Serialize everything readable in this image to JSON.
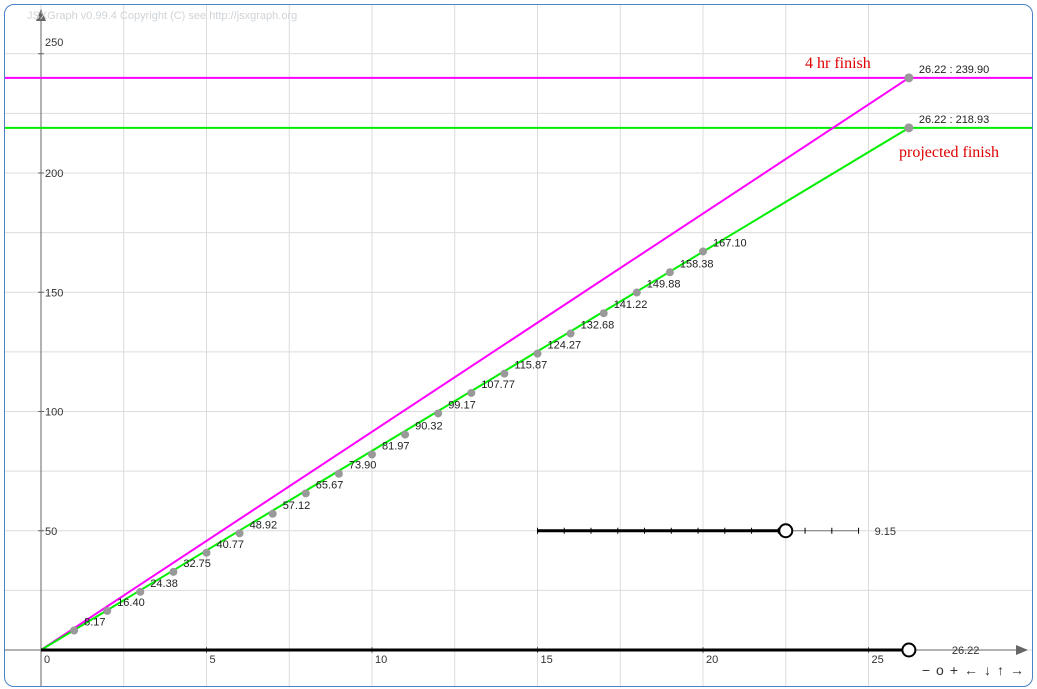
{
  "board": {
    "copyright": "JSXGraph v0.99.4 Copyright (C) see http://jsxgraph.org",
    "nav": [
      {
        "name": "zoom-out-button",
        "label": "−"
      },
      {
        "name": "zoom-reset-button",
        "label": "o"
      },
      {
        "name": "zoom-in-button",
        "label": "+"
      },
      {
        "name": "pan-left-button",
        "label": "←"
      },
      {
        "name": "pan-down-button",
        "label": "↓"
      },
      {
        "name": "pan-up-button",
        "label": "↑"
      },
      {
        "name": "pan-right-button",
        "label": "→"
      }
    ]
  },
  "colors": {
    "grid": "#dcdcdc",
    "axis": "#666666",
    "target_line": "#ff00ff",
    "projected_line": "#00ee00",
    "point": "#999999",
    "annotation": "#dd0000",
    "slider": "#000000"
  },
  "chart_data": {
    "type": "line",
    "xlim": [
      0,
      26.9
    ],
    "ylim": [
      -15,
      270
    ],
    "x_ticks": [
      0,
      5,
      10,
      15,
      20,
      25
    ],
    "x_tick_labels": [
      "0",
      "5",
      "10",
      "15",
      "20",
      "25"
    ],
    "y_ticks": [
      50,
      100,
      150,
      200,
      250
    ],
    "y_tick_labels": [
      "50",
      "100",
      "150",
      "200",
      "250"
    ],
    "grid": true,
    "series": [
      {
        "key": "target",
        "x": [
          0,
          26.22
        ],
        "y": [
          0,
          239.9
        ]
      },
      {
        "key": "projected",
        "x": [
          0,
          26.22
        ],
        "y": [
          0,
          218.93
        ]
      }
    ],
    "hlines": [
      {
        "key": "target",
        "y": 239.9
      },
      {
        "key": "projected",
        "y": 218.93
      }
    ],
    "points": {
      "x": [
        1,
        2,
        3,
        4,
        5,
        6,
        7,
        8,
        9,
        10,
        11,
        12,
        13,
        14,
        15,
        16,
        17,
        18,
        19,
        20
      ],
      "y": [
        8.17,
        16.4,
        24.38,
        32.75,
        40.77,
        48.92,
        57.12,
        65.67,
        73.9,
        81.97,
        90.32,
        99.17,
        107.77,
        115.87,
        124.27,
        132.68,
        141.22,
        149.88,
        158.38,
        167.1
      ],
      "labels": [
        "8.17",
        "16.40",
        "24.38",
        "32.75",
        "40.77",
        "48.92",
        "57.12",
        "65.67",
        "73.90",
        "81.97",
        "90.32",
        "99.17",
        "107.77",
        "115.87",
        "124.27",
        "132.68",
        "141.22",
        "149.88",
        "158.38",
        "167.10"
      ]
    },
    "endpoints": [
      {
        "key": "target",
        "x": 26.22,
        "y": 239.9,
        "label": "26.22 : 239.90"
      },
      {
        "key": "projected",
        "x": 26.22,
        "y": 218.93,
        "label": "26.22 : 218.93"
      }
    ],
    "annotations": [
      {
        "key": "target",
        "text": "4 hr finish"
      },
      {
        "key": "projected",
        "text": "projected finish"
      }
    ],
    "sliders": [
      {
        "name": "pace-slider",
        "start": [
          15,
          50
        ],
        "end": [
          24.7,
          50
        ],
        "value_x": 22.5,
        "value_label": "9.15",
        "ticks": 13
      },
      {
        "name": "distance-slider",
        "start": [
          0,
          0
        ],
        "end": [
          26.22,
          0
        ],
        "value_x": 26.22,
        "value_label": "26.22",
        "ticks": 0
      }
    ]
  }
}
